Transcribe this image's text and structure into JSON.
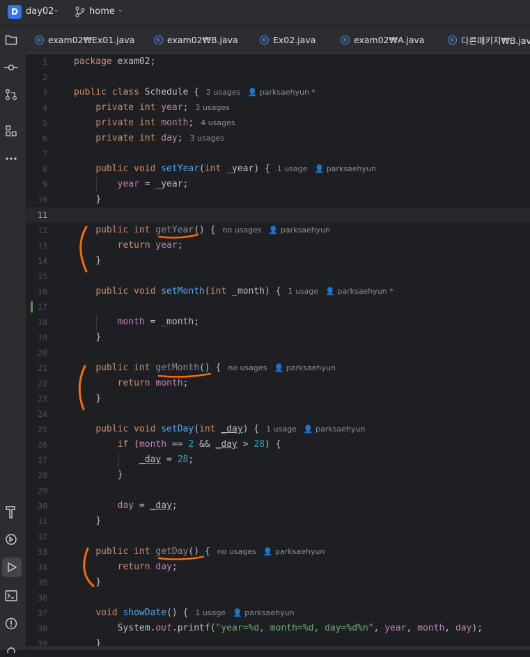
{
  "project": {
    "badge": "D",
    "name": "day02"
  },
  "branch": {
    "name": "home"
  },
  "tabs": [
    {
      "label": "exam02₩Ex01.java"
    },
    {
      "label": "exam02₩B.java"
    },
    {
      "label": "Ex02.java"
    },
    {
      "label": "exam02₩A.java"
    },
    {
      "label": "다른패키지₩B.java"
    }
  ],
  "sidebar_icons": [
    "folder-icon",
    "commit-icon",
    "pull-request-icon",
    "structure-icon",
    "more-icon",
    "build-icon",
    "services-icon",
    "run-icon",
    "terminal-icon",
    "problems-icon"
  ],
  "line_numbers": [
    "1",
    "2",
    "3",
    "4",
    "5",
    "6",
    "7",
    "8",
    "9",
    "10",
    "11",
    "12",
    "13",
    "14",
    "15",
    "16",
    "17",
    "18",
    "19",
    "20",
    "21",
    "22",
    "23",
    "24",
    "25",
    "26",
    "27",
    "28",
    "29",
    "30",
    "31",
    "32",
    "33",
    "34",
    "35",
    "36",
    "37",
    "38",
    "39"
  ],
  "hints": {
    "h3_usages": "2 usages",
    "h3_author": "parksaehyun *",
    "h4": "3 usages",
    "h5": "4 usages",
    "h6": "3 usages",
    "h8_usages": "1 usage",
    "h8_author": "parksaehyun",
    "h12_usages": "no usages",
    "h12_author": "parksaehyun",
    "h16_usages": "1 usage",
    "h16_author": "parksaehyun *",
    "h21_usages": "no usages",
    "h21_author": "parksaehyun",
    "h25_usages": "1 usage",
    "h25_author": "parksaehyun",
    "h33_usages": "no usages",
    "h33_author": "parksaehyun",
    "h37_usages": "1 usage",
    "h37_author": "parksaehyun"
  },
  "code": {
    "l1_package": "package",
    "l1_name": " exam02;",
    "l3_mods": "public class",
    "l3_name": " Schedule {",
    "private": "private",
    "int": "int",
    "f_year": "year",
    "f_month": "month",
    "f_day": "day",
    "semi": ";",
    "public_void": "public void",
    "public_int": "public int",
    "setYear": "setYear",
    "setMonth": "setMonth",
    "setDay": "setDay",
    "getYear": "getYear",
    "getMonth": "getMonth",
    "getDay": "getDay",
    "p_year": "_year",
    "p_month": "_month",
    "p_day": "_day",
    "return": "return",
    "if": "if",
    "void": "void",
    "showDate": "showDate",
    "system": "System.",
    "out": "out",
    "printf": ".printf(",
    "fmt": "\"year=%d, month=%d, day=%d%n\"",
    "two": "2",
    "twentyeight": "28",
    "brace_close": "}",
    "brace_open": " {",
    "eq": " = ",
    "paren_empty": "()",
    "open_paren_int": "(",
    "close_paren_brace": ") {"
  },
  "colors": {
    "annotation": "#ff6a00",
    "keyword": "#cf8e6d",
    "field": "#c77dbb",
    "method": "#56a8f5",
    "number": "#2aacb8",
    "string": "#6aab73"
  }
}
